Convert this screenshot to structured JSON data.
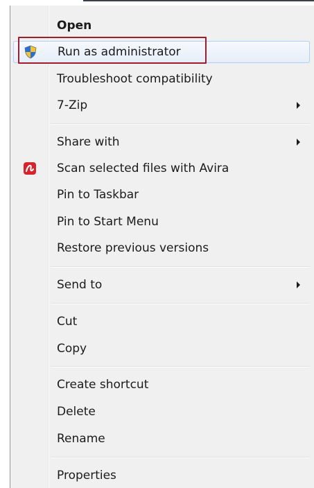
{
  "menu": {
    "items": [
      {
        "id": "open",
        "label": "Open",
        "bold": true,
        "submenu": false
      },
      {
        "id": "run-as-admin",
        "label": "Run as administrator",
        "icon": "shield-icon",
        "highlighted": true
      },
      {
        "id": "troubleshoot",
        "label": "Troubleshoot compatibility"
      },
      {
        "id": "7zip",
        "label": "7-Zip",
        "submenu": true
      },
      {
        "id": "share-with",
        "label": "Share with",
        "submenu": true
      },
      {
        "id": "scan-avira",
        "label": "Scan selected files with Avira",
        "icon": "avira-icon"
      },
      {
        "id": "pin-taskbar",
        "label": "Pin to Taskbar"
      },
      {
        "id": "pin-start",
        "label": "Pin to Start Menu"
      },
      {
        "id": "restore",
        "label": "Restore previous versions"
      },
      {
        "id": "send-to",
        "label": "Send to",
        "submenu": true
      },
      {
        "id": "cut",
        "label": "Cut"
      },
      {
        "id": "copy",
        "label": "Copy"
      },
      {
        "id": "create-shortcut",
        "label": "Create shortcut"
      },
      {
        "id": "delete",
        "label": "Delete"
      },
      {
        "id": "rename",
        "label": "Rename"
      },
      {
        "id": "properties",
        "label": "Properties"
      }
    ]
  },
  "colors": {
    "menu_bg": "#f0f0f0",
    "highlight_border": "#aecff7",
    "callout_border": "#a01c2a",
    "avira_red": "#d8232a",
    "shield_blue": "#2a6fd1",
    "shield_yellow": "#f4c430"
  }
}
